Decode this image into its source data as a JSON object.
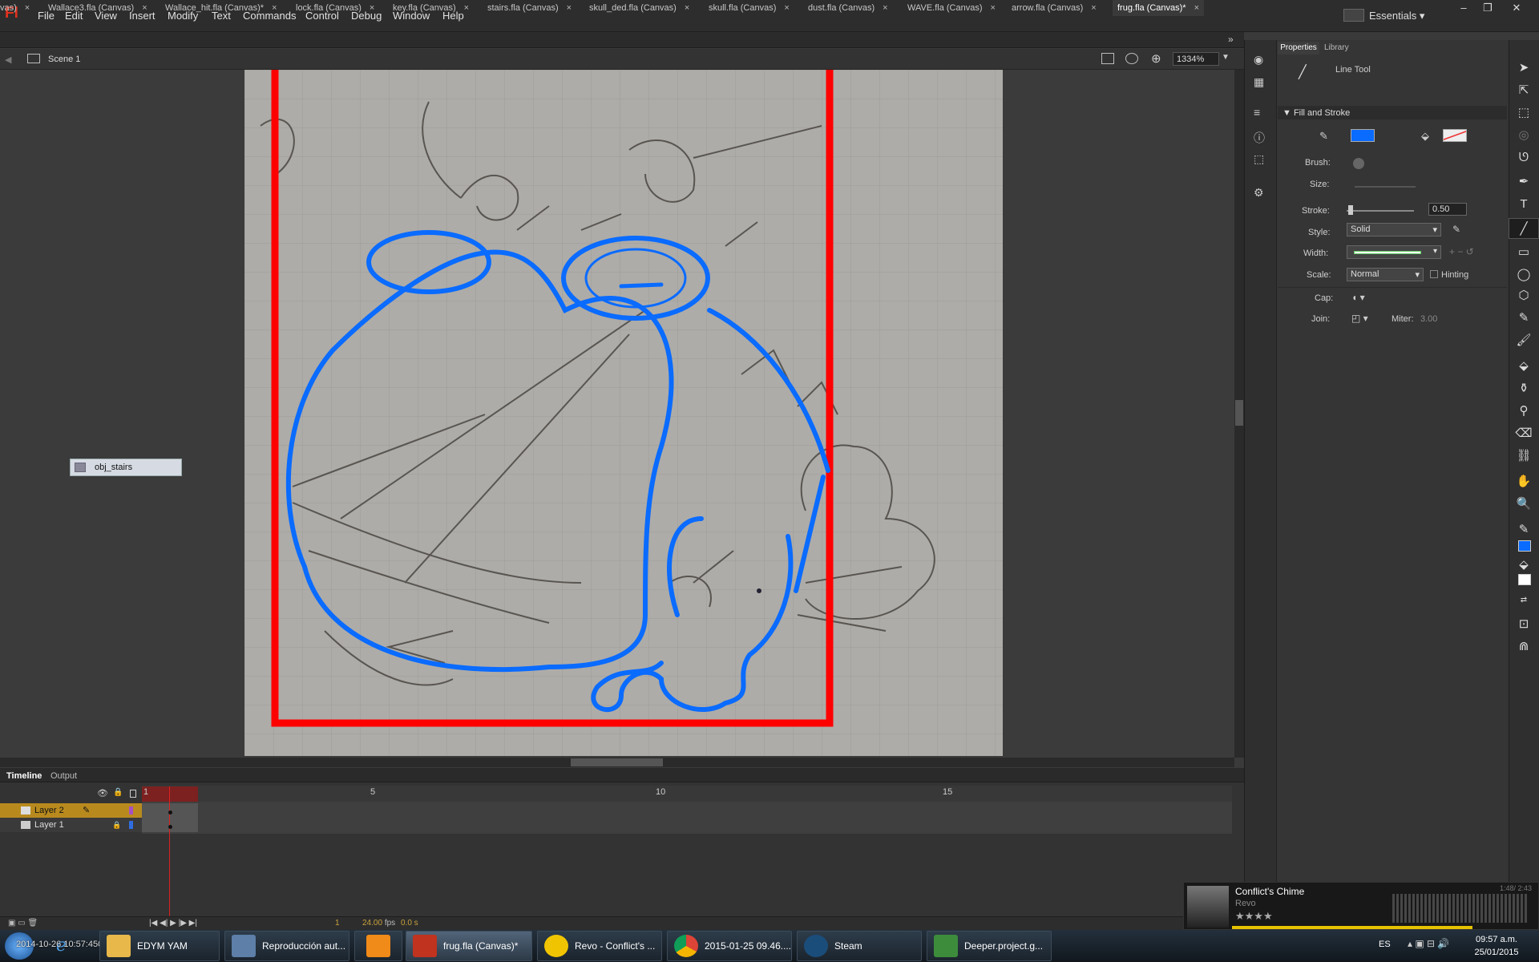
{
  "app": {
    "logo": "Fl",
    "menu": [
      "File",
      "Edit",
      "View",
      "Insert",
      "Modify",
      "Text",
      "Commands",
      "Control",
      "Debug",
      "Window",
      "Help"
    ],
    "workspace": "Essentials",
    "window_controls": [
      "–",
      "❐",
      "✕"
    ]
  },
  "tabs": [
    {
      "label": "vas)",
      "active": false
    },
    {
      "label": "Wallace3.fla (Canvas)",
      "active": false
    },
    {
      "label": "Wallace_hit.fla (Canvas)*",
      "active": false
    },
    {
      "label": "lock.fla (Canvas)",
      "active": false
    },
    {
      "label": "key.fla (Canvas)",
      "active": false
    },
    {
      "label": "stairs.fla (Canvas)",
      "active": false
    },
    {
      "label": "skull_ded.fla (Canvas)",
      "active": false
    },
    {
      "label": "skull.fla (Canvas)",
      "active": false
    },
    {
      "label": "dust.fla (Canvas)",
      "active": false
    },
    {
      "label": "WAVE.fla (Canvas)",
      "active": false
    },
    {
      "label": "arrow.fla (Canvas)",
      "active": false
    },
    {
      "label": "frug.fla (Canvas)*",
      "active": true
    }
  ],
  "editbar": {
    "scene": "Scene 1",
    "zoom": "1334%"
  },
  "stage": {
    "symbol_label": "obj_stairs",
    "stroke_color": "#0a6bff",
    "border_color": "#ff0000"
  },
  "timeline": {
    "tabs": [
      "Timeline",
      "Output"
    ],
    "frame_numbers": [
      "1",
      "5",
      "10",
      "15"
    ],
    "layers": [
      {
        "name": "Layer 2",
        "color": "#a64fc4",
        "selected": true
      },
      {
        "name": "Layer 1",
        "color": "#2f6de0",
        "selected": false
      }
    ],
    "current_frame": "1",
    "fps": "24.00",
    "fps_unit": "fps",
    "time": "0.0 s"
  },
  "properties": {
    "tabs": [
      "Properties",
      "Library"
    ],
    "tool_name": "Line Tool",
    "section": "Fill and Stroke",
    "stroke_color": "#0a6bff",
    "brush_label": "Brush:",
    "size_label": "Size:",
    "stroke_label": "Stroke:",
    "stroke_value": "0.50",
    "style_label": "Style:",
    "style_value": "Solid",
    "width_label": "Width:",
    "scale_label": "Scale:",
    "scale_value": "Normal",
    "hinting_label": "Hinting",
    "cap_label": "Cap:",
    "join_label": "Join:",
    "miter_label": "Miter:",
    "miter_value": "3.00"
  },
  "music": {
    "title": "Conflict's Chime",
    "artist": "Revo",
    "time": "1:48/ 2:43",
    "rating": "★★★★"
  },
  "taskbar": {
    "items": [
      {
        "label": "EDYM YAM",
        "color": "#e8b84a"
      },
      {
        "label": "Reproducción aut...",
        "color": "#5d7fa8"
      },
      {
        "label": "",
        "color": "#f08a18"
      },
      {
        "label": "frug.fla (Canvas)*",
        "color": "#c0331f"
      },
      {
        "label": "Revo - Conflict's ...",
        "color": "#f0c400"
      },
      {
        "label": "2015-01-25 09.46....",
        "color": "#3aa757"
      },
      {
        "label": "Steam",
        "color": "#1b4d7a"
      },
      {
        "label": "Deeper.project.g...",
        "color": "#3c8c3c"
      }
    ],
    "overlay_text": "2014-10-26 10:57:450",
    "lang": "ES",
    "time": "09:57 a.m.",
    "date": "25/01/2015"
  }
}
